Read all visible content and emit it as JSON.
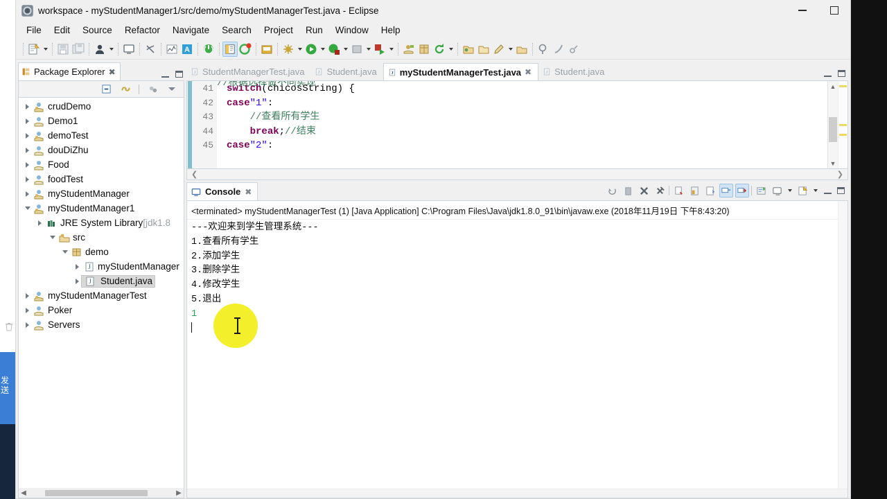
{
  "window": {
    "title": "workspace - myStudentManager1/src/demo/myStudentManagerTest.java - Eclipse",
    "app_icon": "eclipse-icon",
    "minimize_label": "minimize-button",
    "maximize_label": "maximize-button"
  },
  "menubar": {
    "items": [
      {
        "label": "File"
      },
      {
        "label": "Edit"
      },
      {
        "label": "Source"
      },
      {
        "label": "Refactor"
      },
      {
        "label": "Navigate"
      },
      {
        "label": "Search"
      },
      {
        "label": "Project"
      },
      {
        "label": "Run"
      },
      {
        "label": "Window"
      },
      {
        "label": "Help"
      }
    ]
  },
  "toolbar": {
    "items": [
      {
        "name": "new-wizard-icon"
      },
      {
        "name": "new-dropdown-arrow"
      },
      {
        "name": "save-icon"
      },
      {
        "name": "save-all-icon"
      },
      {
        "name": "person-icon"
      },
      {
        "name": "person-dropdown-arrow"
      },
      {
        "name": "console-icon"
      },
      {
        "name": "skip-breakpoints-icon"
      },
      {
        "name": "chart-icon"
      },
      {
        "name": "annotation-icon"
      },
      {
        "name": "resume-icon"
      },
      {
        "name": "toggle-editor-icon"
      },
      {
        "name": "debug-error-icon"
      },
      {
        "name": "open-type-icon"
      },
      {
        "name": "debug-icon"
      },
      {
        "name": "debug-dropdown-arrow"
      },
      {
        "name": "run-icon"
      },
      {
        "name": "run-dropdown-arrow"
      },
      {
        "name": "coverage-icon"
      },
      {
        "name": "coverage-dropdown-arrow"
      },
      {
        "name": "external-tools-icon"
      },
      {
        "name": "external-tools-dropdown-arrow"
      },
      {
        "name": "run-last-tool-icon"
      },
      {
        "name": "run-last-tool-dropdown-arrow"
      },
      {
        "name": "new-java-project-icon"
      },
      {
        "name": "new-package-icon"
      },
      {
        "name": "refresh-icon"
      },
      {
        "name": "refresh-dropdown-arrow"
      },
      {
        "name": "open-folder-icon"
      },
      {
        "name": "folder-icon"
      },
      {
        "name": "edit-pencil-icon"
      },
      {
        "name": "edit-dropdown-arrow"
      },
      {
        "name": "package-icon"
      },
      {
        "name": "search-pin-icon"
      },
      {
        "name": "quick-access-icon"
      },
      {
        "name": "link-icon"
      }
    ]
  },
  "package_explorer": {
    "tab_label": "Package Explorer",
    "tab_icon": "package-explorer-icon",
    "close_icon": "close-icon",
    "view_toolbar": [
      {
        "name": "collapse-all-icon"
      },
      {
        "name": "link-with-editor-icon"
      },
      {
        "name": "focus-on-active-task-icon"
      },
      {
        "name": "view-menu-icon"
      }
    ],
    "minimize_icon": "view-minimize-icon",
    "maximize_icon": "view-maximize-icon",
    "tree": [
      {
        "label": "crudDemo",
        "indent": 0,
        "twisty": "closed",
        "icon": "java-project-icon",
        "selected": false
      },
      {
        "label": "Demo1",
        "indent": 0,
        "twisty": "closed",
        "icon": "project-icon",
        "selected": false
      },
      {
        "label": "demoTest",
        "indent": 0,
        "twisty": "closed",
        "icon": "java-project-icon",
        "selected": false
      },
      {
        "label": "douDiZhu",
        "indent": 0,
        "twisty": "closed",
        "icon": "project-icon",
        "selected": false
      },
      {
        "label": "Food",
        "indent": 0,
        "twisty": "closed",
        "icon": "project-icon",
        "selected": false
      },
      {
        "label": "foodTest",
        "indent": 0,
        "twisty": "closed",
        "icon": "project-icon",
        "selected": false
      },
      {
        "label": "myStudentManager",
        "indent": 0,
        "twisty": "closed",
        "icon": "java-project-icon",
        "selected": false
      },
      {
        "label": "myStudentManager1",
        "indent": 0,
        "twisty": "open",
        "icon": "java-project-icon",
        "selected": false
      },
      {
        "label": "JRE System Library",
        "indent": 1,
        "twisty": "closed",
        "icon": "library-icon",
        "selected": false,
        "suffix": " [jdk1.8",
        "dim_suffix": true
      },
      {
        "label": "src",
        "indent": 1,
        "twisty": "open",
        "icon": "source-folder-icon",
        "selected": false
      },
      {
        "label": "demo",
        "indent": 2,
        "twisty": "open",
        "icon": "package-icon",
        "selected": false
      },
      {
        "label": "myStudentManager",
        "indent": 3,
        "twisty": "closed",
        "icon": "java-file-icon",
        "selected": false
      },
      {
        "label": "Student.java",
        "indent": 3,
        "twisty": "closed",
        "icon": "java-file-icon",
        "selected": true
      },
      {
        "label": "myStudentManagerTest",
        "indent": 0,
        "twisty": "closed",
        "icon": "java-project-icon",
        "selected": false
      },
      {
        "label": "Poker",
        "indent": 0,
        "twisty": "closed",
        "icon": "project-icon",
        "selected": false
      },
      {
        "label": "Servers",
        "indent": 0,
        "twisty": "closed",
        "icon": "project-icon",
        "selected": false
      }
    ]
  },
  "editor": {
    "tabs": [
      {
        "label": "StudentManagerTest.java",
        "active": false,
        "icon": "java-file-icon"
      },
      {
        "label": "Student.java",
        "active": false,
        "icon": "java-file-icon"
      },
      {
        "label": "myStudentManagerTest.java",
        "active": true,
        "icon": "java-file-icon",
        "close_icon": "close-icon"
      },
      {
        "label": "Student.java",
        "active": false,
        "icon": "java-file-icon"
      }
    ],
    "minimize_icon": "view-minimize-icon",
    "maximize_icon": "view-maximize-icon",
    "clipped_top_comment": "//根据选择做不同实现",
    "line_numbers": [
      "41",
      "42",
      "43",
      "44",
      "45"
    ],
    "lines": [
      [
        {
          "t": "switch",
          "c": "kw"
        },
        {
          "t": "(chicosString) {",
          "c": "pl"
        }
      ],
      [
        {
          "t": "case",
          "c": "kw"
        },
        {
          "t": "\"1\"",
          "c": "str"
        },
        {
          "t": ":",
          "c": "pl"
        }
      ],
      [
        {
          "t": "    //查看所有学生",
          "c": "cm"
        }
      ],
      [
        {
          "t": "    ",
          "c": "pl"
        },
        {
          "t": "break",
          "c": "kw"
        },
        {
          "t": ";",
          "c": "pl"
        },
        {
          "t": "//结束",
          "c": "cm"
        }
      ],
      [
        {
          "t": "case",
          "c": "kw"
        },
        {
          "t": "\"2\"",
          "c": "str"
        },
        {
          "t": ":",
          "c": "pl"
        }
      ]
    ],
    "hscroll_left_icon": "scroll-left-arrow",
    "hscroll_right_icon": "scroll-right-arrow"
  },
  "console": {
    "tab_label": "Console",
    "tab_icon": "console-icon",
    "close_icon": "close-icon",
    "toolbar": [
      {
        "name": "terminate-all-icon"
      },
      {
        "name": "remove-launch-icon"
      },
      {
        "name": "remove-all-terminated-icon"
      },
      {
        "name": "clear-console-icon"
      },
      {
        "name": "scroll-lock-icon"
      },
      {
        "name": "pin-console-icon"
      },
      {
        "name": "show-console-on-output-icon"
      },
      {
        "name": "display-selected-console-icon"
      },
      {
        "name": "open-console-icon"
      },
      {
        "name": "word-wrap-icon"
      },
      {
        "name": "new-console-view-icon"
      },
      {
        "name": "new-console-dropdown-arrow"
      },
      {
        "name": "console-menu-icon"
      },
      {
        "name": "console-menu-dropdown-arrow"
      }
    ],
    "minimize_icon": "view-minimize-icon",
    "maximize_icon": "view-maximize-icon",
    "status_line": "<terminated> myStudentManagerTest (1) [Java Application] C:\\Program Files\\Java\\jdk1.8.0_91\\bin\\javaw.exe (2018年11月19日 下午8:43:20)",
    "output": [
      {
        "text": "---欢迎来到学生管理系统---",
        "kind": "stdout"
      },
      {
        "text": "1.查看所有学生",
        "kind": "stdout"
      },
      {
        "text": "2.添加学生",
        "kind": "stdout"
      },
      {
        "text": "3.删除学生",
        "kind": "stdout"
      },
      {
        "text": "4.修改学生",
        "kind": "stdout"
      },
      {
        "text": "5.退出",
        "kind": "stdout"
      },
      {
        "text": "1",
        "kind": "stdin"
      }
    ]
  },
  "background_panel": {
    "text": "发送",
    "trash_icon": "trash-icon"
  },
  "cursor": {
    "type": "i-beam-cursor",
    "click_highlight": "click-highlight"
  },
  "colors": {
    "accent": "#3a7fd5",
    "keyword": "#7f0055",
    "string": "#2a00ff",
    "comment": "#3f7f5f",
    "stdin": "#2e9b5a",
    "highlight": "#f2ef19",
    "selection": "#d8d8d8"
  }
}
